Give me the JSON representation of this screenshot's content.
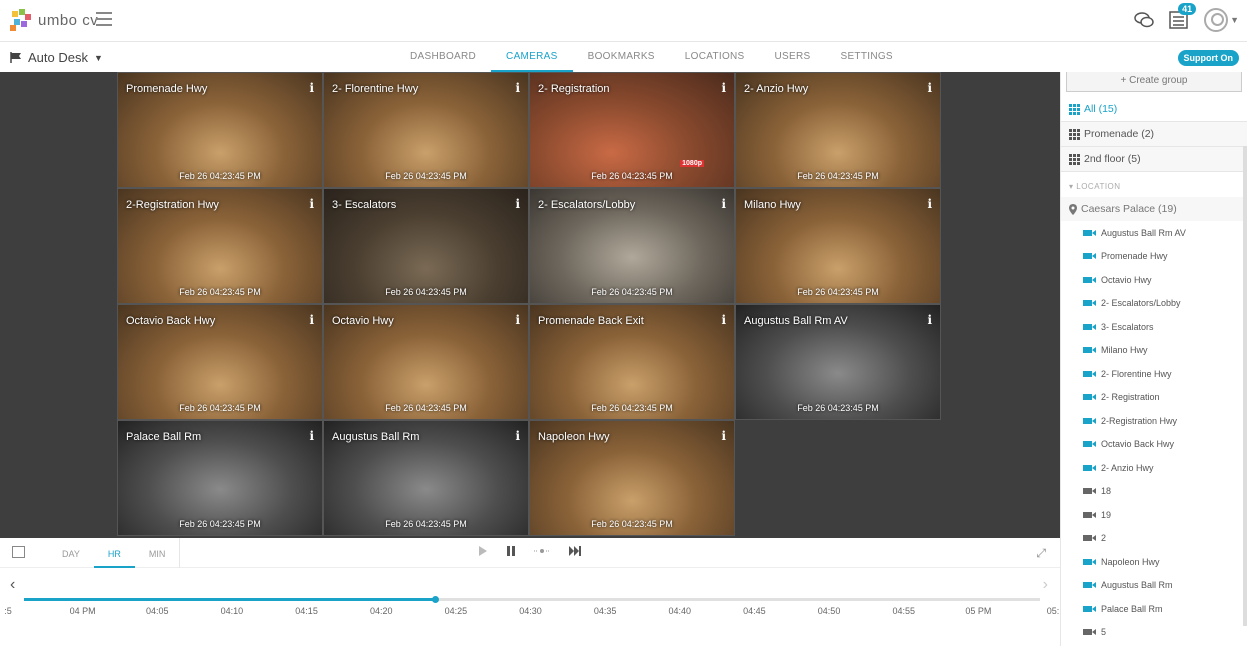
{
  "app": {
    "logo_text": "umbo cv",
    "notification_count": "41",
    "support_label": "Support On"
  },
  "navbar": {
    "site_label": "Auto Desk",
    "tabs": [
      {
        "label": "DASHBOARD",
        "active": false
      },
      {
        "label": "CAMERAS",
        "active": true
      },
      {
        "label": "BOOKMARKS",
        "active": false
      },
      {
        "label": "LOCATIONS",
        "active": false
      },
      {
        "label": "USERS",
        "active": false
      },
      {
        "label": "SETTINGS",
        "active": false
      }
    ]
  },
  "cameras": [
    {
      "name": "Promenade Hwy",
      "time": "Feb 26 04:23:45 PM",
      "tone": "warm"
    },
    {
      "name": "2- Florentine Hwy",
      "time": "Feb 26 04:23:45 PM",
      "tone": "warm"
    },
    {
      "name": "2- Registration",
      "time": "Feb 26 04:23:45 PM",
      "tone": "red",
      "badge": "1080p"
    },
    {
      "name": "2- Anzio Hwy",
      "time": "Feb 26 04:23:45 PM",
      "tone": "warm"
    },
    {
      "name": "2-Registration Hwy",
      "time": "Feb 26 04:23:45 PM",
      "tone": "warm"
    },
    {
      "name": "3- Escalators",
      "time": "Feb 26 04:23:45 PM",
      "tone": "dark"
    },
    {
      "name": "2- Escalators/Lobby",
      "time": "Feb 26 04:23:45 PM",
      "tone": "grey"
    },
    {
      "name": "Milano Hwy",
      "time": "Feb 26 04:23:45 PM",
      "tone": "warm"
    },
    {
      "name": "Octavio Back Hwy",
      "time": "Feb 26 04:23:45 PM",
      "tone": "warm"
    },
    {
      "name": "Octavio Hwy",
      "time": "Feb 26 04:23:45 PM",
      "tone": "warm"
    },
    {
      "name": "Promenade Back Exit",
      "time": "Feb 26 04:23:45 PM",
      "tone": "warm"
    },
    {
      "name": "Augustus Ball Rm AV",
      "time": "Feb 26 04:23:45 PM",
      "tone": "bw"
    },
    {
      "name": "Palace Ball Rm",
      "time": "Feb 26 04:23:45 PM",
      "tone": "bw"
    },
    {
      "name": "Augustus Ball Rm",
      "time": "Feb 26 04:23:45 PM",
      "tone": "bw"
    },
    {
      "name": "Napoleon Hwy",
      "time": "Feb 26 04:23:45 PM",
      "tone": "warm"
    }
  ],
  "controls": {
    "zoom_tabs": [
      {
        "label": "DAY",
        "active": false
      },
      {
        "label": "HR",
        "active": true
      },
      {
        "label": "MIN",
        "active": false
      }
    ]
  },
  "timeline": {
    "progress": 0.405,
    "ticks": [
      ":5",
      "04 PM",
      "04:05",
      "04:10",
      "04:15",
      "04:20",
      "04:25",
      "04:30",
      "04:35",
      "04:40",
      "04:45",
      "04:50",
      "04:55",
      "05 PM",
      "05:"
    ]
  },
  "sidebar": {
    "create_group_label": "Create group",
    "groups": [
      {
        "label": "All (15)",
        "active": true
      },
      {
        "label": "Promenade (2)",
        "active": false
      },
      {
        "label": "2nd floor (5)",
        "active": false
      }
    ],
    "location_heading": "LOCATION",
    "location_name": "Caesars Palace (19)",
    "cameras": [
      {
        "label": "Augustus Ball Rm AV",
        "online": true
      },
      {
        "label": "Promenade Hwy",
        "online": true
      },
      {
        "label": "Octavio Hwy",
        "online": true
      },
      {
        "label": "2- Escalators/Lobby",
        "online": true
      },
      {
        "label": "3- Escalators",
        "online": true
      },
      {
        "label": "Milano Hwy",
        "online": true
      },
      {
        "label": "2- Florentine Hwy",
        "online": true
      },
      {
        "label": "2- Registration",
        "online": true
      },
      {
        "label": "2-Registration Hwy",
        "online": true
      },
      {
        "label": "Octavio Back Hwy",
        "online": true
      },
      {
        "label": "2- Anzio Hwy",
        "online": true
      },
      {
        "label": "18",
        "online": false
      },
      {
        "label": "19",
        "online": false
      },
      {
        "label": "2",
        "online": false
      },
      {
        "label": "Napoleon Hwy",
        "online": true
      },
      {
        "label": "Augustus Ball Rm",
        "online": true
      },
      {
        "label": "Palace Ball Rm",
        "online": true
      },
      {
        "label": "5",
        "online": false
      }
    ]
  },
  "colors": {
    "accent": "#1aa3c9"
  }
}
